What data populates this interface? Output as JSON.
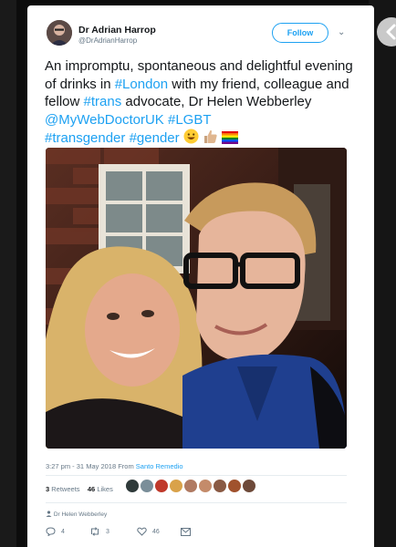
{
  "author": {
    "name": "Dr Adrian Harrop",
    "handle": "@DrAdrianHarrop"
  },
  "follow_label": "Follow",
  "tweet": {
    "text_1": "An impromptu, spontaneous and delightful evening of drinks in ",
    "link_london": "#London",
    "text_2": " with my friend, colleague and fellow ",
    "link_trans": "#trans",
    "text_3": " advocate, Dr Helen Webberley ",
    "link_mention": "@MyWebDoctorUK",
    "text_4": " ",
    "link_lgbt": "#LGBT",
    "link_transgender": "#transgender",
    "link_gender": "#gender",
    "emojis": [
      "smiling-face",
      "thumbs-up",
      "rainbow-flag"
    ]
  },
  "timestamp": "3:27 pm - 31 May 2018 From ",
  "source": "Santo Remedio",
  "stats": {
    "retweets_count": "3",
    "retweets_label": "Retweets",
    "likes_count": "46",
    "likes_label": "Likes"
  },
  "liker_avatar_colors": [
    "#2f3a3a",
    "#7a8e99",
    "#c0392b",
    "#d9a24a",
    "#b07a62",
    "#c48b6a",
    "#8a5a44",
    "#a0522d",
    "#6e4a3a"
  ],
  "reply_context": "Dr Helen Webberley",
  "actions": {
    "reply_count": "4",
    "retweet_count": "3",
    "like_count": "46"
  },
  "colors": {
    "link": "#1da1f2",
    "text": "#14171a",
    "muted": "#657786"
  }
}
